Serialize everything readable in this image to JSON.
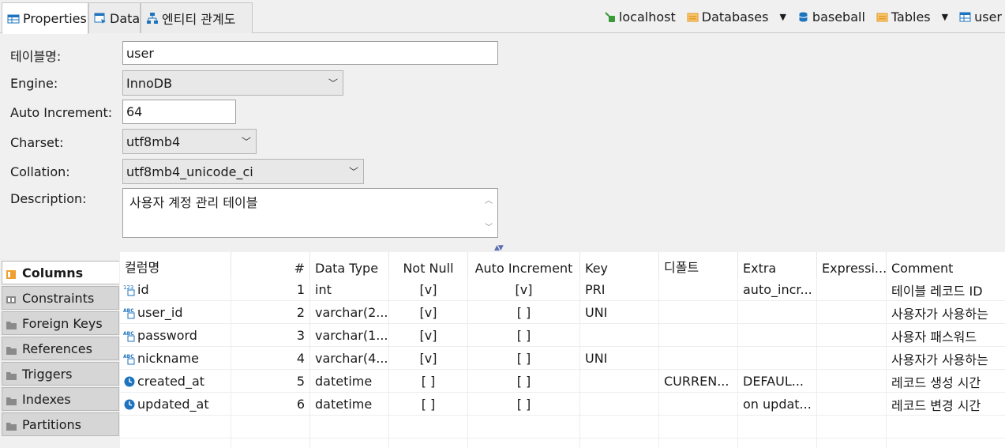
{
  "tabs": [
    {
      "label": "Properties",
      "icon": "table-icon"
    },
    {
      "label": "Data",
      "icon": "data-grid-icon"
    },
    {
      "label": "엔티티 관계도",
      "icon": "er-diagram-icon"
    }
  ],
  "breadcrumb": {
    "host": "localhost",
    "databases": "Databases",
    "schema": "baseball",
    "tables": "Tables",
    "table": "user"
  },
  "form": {
    "table_name_label": "테이블명:",
    "table_name_value": "user",
    "engine_label": "Engine:",
    "engine_value": "InnoDB",
    "auto_increment_label": "Auto Increment:",
    "auto_increment_value": "64",
    "charset_label": "Charset:",
    "charset_value": "utf8mb4",
    "collation_label": "Collation:",
    "collation_value": "utf8mb4_unicode_ci",
    "description_label": "Description:",
    "description_value": "사용자 계정 관리 테이블"
  },
  "side_tabs": [
    {
      "label": "Columns",
      "active": true
    },
    {
      "label": "Constraints",
      "active": false
    },
    {
      "label": "Foreign Keys",
      "active": false
    },
    {
      "label": "References",
      "active": false
    },
    {
      "label": "Triggers",
      "active": false
    },
    {
      "label": "Indexes",
      "active": false
    },
    {
      "label": "Partitions",
      "active": false
    }
  ],
  "columns_table": {
    "headers": [
      "컬럼명",
      "#",
      "Data Type",
      "Not Null",
      "Auto Increment",
      "Key",
      "디폴트",
      "Extra",
      "Expressi...",
      "Comment"
    ],
    "rows": [
      {
        "icon": "numeric-type-icon",
        "name": "id",
        "num": "1",
        "type": "int",
        "not_null": "[v]",
        "auto_inc": "[v]",
        "key": "PRI",
        "default": "",
        "extra": "auto_incr...",
        "expr": "",
        "comment": "테이블 레코드 ID"
      },
      {
        "icon": "string-type-icon",
        "name": "user_id",
        "num": "2",
        "type": "varchar(2...",
        "not_null": "[v]",
        "auto_inc": "[ ]",
        "key": "UNI",
        "default": "",
        "extra": "",
        "expr": "",
        "comment": "사용자가 사용하는"
      },
      {
        "icon": "string-type-icon",
        "name": "password",
        "num": "3",
        "type": "varchar(1...",
        "not_null": "[v]",
        "auto_inc": "[ ]",
        "key": "",
        "default": "",
        "extra": "",
        "expr": "",
        "comment": "사용자 패스워드"
      },
      {
        "icon": "string-type-icon",
        "name": "nickname",
        "num": "4",
        "type": "varchar(4...",
        "not_null": "[v]",
        "auto_inc": "[ ]",
        "key": "UNI",
        "default": "",
        "extra": "",
        "expr": "",
        "comment": "사용자가 사용하는"
      },
      {
        "icon": "datetime-type-icon",
        "name": "created_at",
        "num": "5",
        "type": "datetime",
        "not_null": "[ ]",
        "auto_inc": "[ ]",
        "key": "",
        "default": "CURREN...",
        "extra": "DEFAUL...",
        "expr": "",
        "comment": "레코드 생성 시간"
      },
      {
        "icon": "datetime-type-icon",
        "name": "updated_at",
        "num": "6",
        "type": "datetime",
        "not_null": "[ ]",
        "auto_inc": "[ ]",
        "key": "",
        "default": "",
        "extra": "on updat...",
        "expr": "",
        "comment": "레코드 변경 시간"
      }
    ]
  },
  "colors": {
    "accent": "#1e73be",
    "folder": "#f0a030",
    "sidetab_bg": "#d6d6d6"
  }
}
